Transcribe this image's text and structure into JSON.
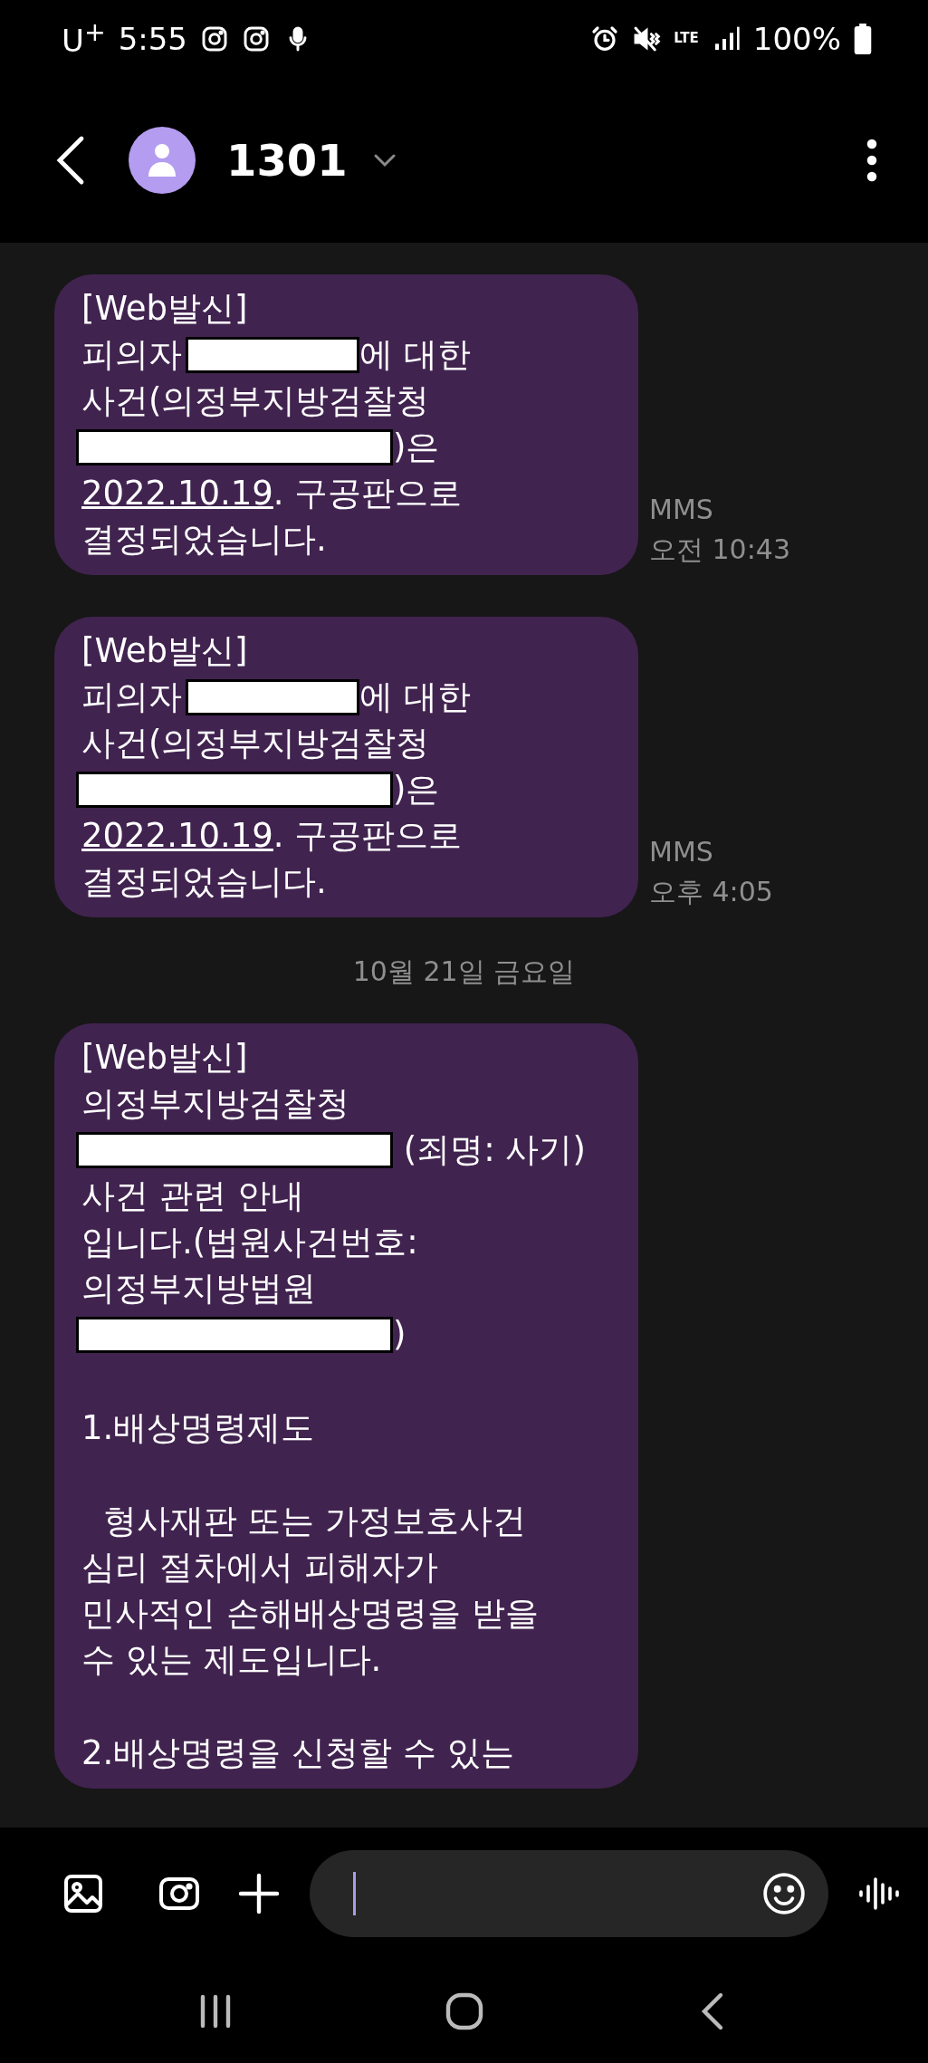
{
  "status_bar": {
    "carrier": "U$^{+}$",
    "time": "5:55",
    "network": "LTE",
    "battery": "100%"
  },
  "header": {
    "title": "1301"
  },
  "chat": [
    {
      "kind": "message",
      "label": "MMS",
      "time": "오전 10:43",
      "paragraphs": [
        [
          [
            {
              "kind": "text",
              "text": "[Web발신]"
            }
          ],
          [
            {
              "kind": "text",
              "text": "피의자 "
            },
            {
              "kind": "redaction-short"
            },
            {
              "kind": "text",
              "text": "에 대한"
            }
          ],
          [
            {
              "kind": "text",
              "text": "사건(의정부지방검찰청"
            }
          ],
          [
            {
              "kind": "redaction-long"
            },
            {
              "kind": "text",
              "text": ")은"
            }
          ],
          [
            {
              "kind": "link",
              "text": "2022.10.19"
            },
            {
              "kind": "text",
              "text": ". 구공판으로"
            }
          ],
          [
            {
              "kind": "text",
              "text": "결정되었습니다."
            }
          ]
        ]
      ]
    },
    {
      "kind": "message",
      "label": "MMS",
      "time": "오후 4:05",
      "paragraphs": [
        [
          [
            {
              "kind": "text",
              "text": "[Web발신]"
            }
          ],
          [
            {
              "kind": "text",
              "text": "피의자 "
            },
            {
              "kind": "redaction-short"
            },
            {
              "kind": "text",
              "text": "에 대한"
            }
          ],
          [
            {
              "kind": "text",
              "text": "사건(의정부지방검찰청"
            }
          ],
          [
            {
              "kind": "redaction-long"
            },
            {
              "kind": "text",
              "text": ")은"
            }
          ],
          [
            {
              "kind": "link",
              "text": "2022.10.19"
            },
            {
              "kind": "text",
              "text": ". 구공판으로"
            }
          ],
          [
            {
              "kind": "text",
              "text": "결정되었습니다."
            }
          ]
        ]
      ]
    },
    {
      "kind": "date",
      "text": "10월 21일 금요일"
    },
    {
      "kind": "message",
      "paragraphs": [
        [
          [
            {
              "kind": "text",
              "text": "[Web발신]"
            }
          ],
          [
            {
              "kind": "text",
              "text": "의정부지방검찰청"
            }
          ],
          [
            {
              "kind": "redaction-long"
            },
            {
              "kind": "text",
              "text": " (죄명: 사기)"
            }
          ],
          [
            {
              "kind": "text",
              "text": "사건 관련 안내"
            }
          ],
          [
            {
              "kind": "text",
              "text": "입니다.(법원사건번호:"
            }
          ],
          [
            {
              "kind": "text",
              "text": "의정부지방법원"
            }
          ],
          [
            {
              "kind": "redaction-long"
            },
            {
              "kind": "text",
              "text": ")"
            }
          ]
        ],
        [
          [
            {
              "kind": "text",
              "text": "1.배상명령제도"
            }
          ]
        ],
        [
          [
            {
              "kind": "text",
              "text": "  형사재판 또는 가정보호사건"
            }
          ],
          [
            {
              "kind": "text",
              "text": "심리 절차에서 피해자가"
            }
          ],
          [
            {
              "kind": "text",
              "text": "민사적인 손해배상명령을 받을"
            }
          ],
          [
            {
              "kind": "text",
              "text": "수 있는 제도입니다."
            }
          ]
        ],
        [
          [
            {
              "kind": "text",
              "text": "2.배상명령을 신청할 수 있는"
            }
          ]
        ]
      ]
    }
  ]
}
